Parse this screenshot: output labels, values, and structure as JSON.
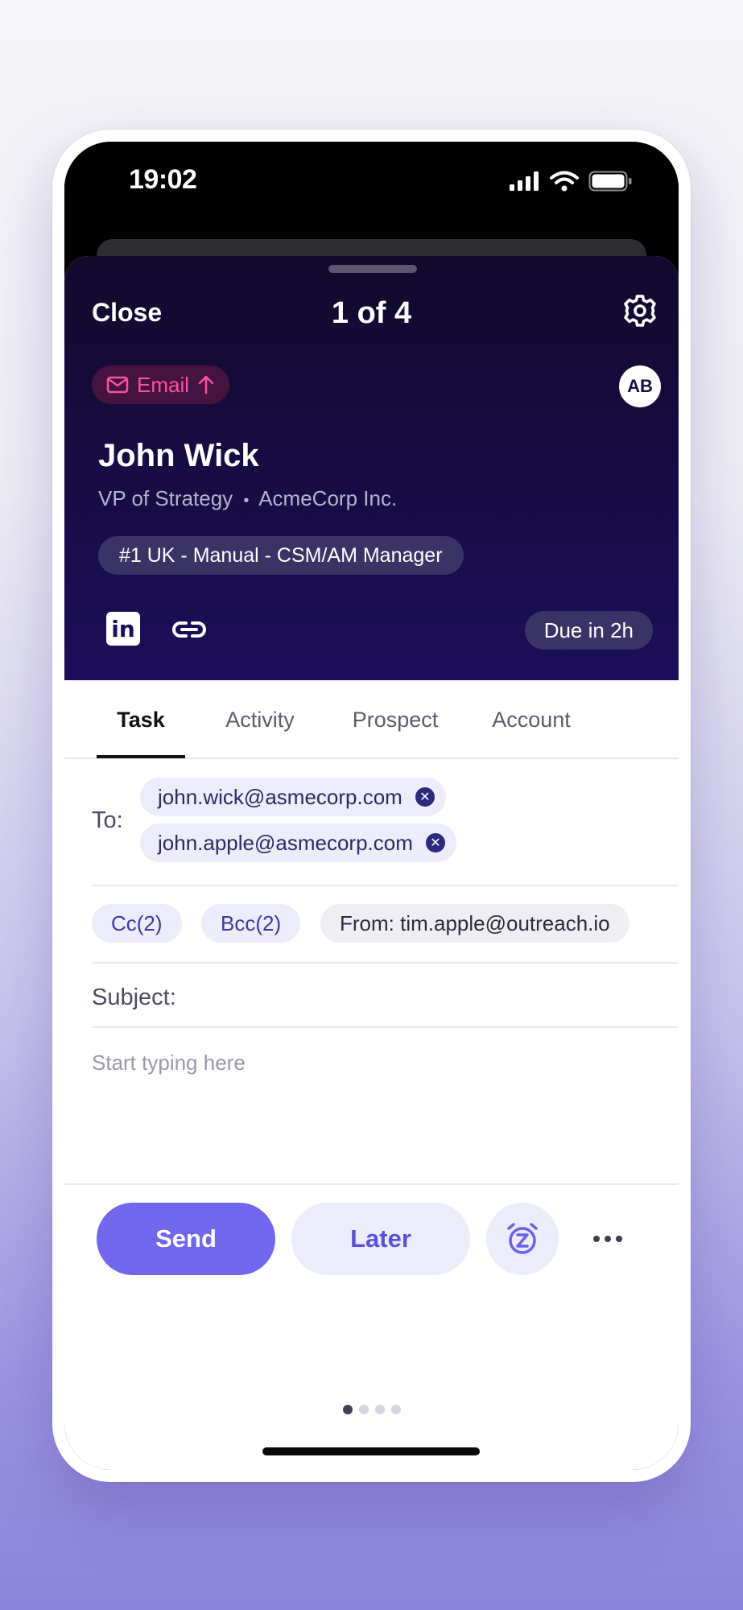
{
  "status_bar": {
    "time": "19:02"
  },
  "header": {
    "close_label": "Close",
    "counter": "1 of 4",
    "type_chip": "Email",
    "avatar_initials": "AB",
    "prospect_name": "John Wick",
    "prospect_title": "VP of Strategy",
    "prospect_company": "AcmeCorp Inc.",
    "role_separator": "•",
    "sequence": "#1 UK - Manual - CSM/AM Manager",
    "linkedin_glyph": "in",
    "due": "Due in 2h"
  },
  "tabs": [
    {
      "label": "Task",
      "active": true
    },
    {
      "label": "Activity",
      "active": false
    },
    {
      "label": "Prospect",
      "active": false
    },
    {
      "label": "Account",
      "active": false
    }
  ],
  "compose": {
    "to_label": "To:",
    "recipients": [
      "john.wick@asmecorp.com",
      "john.apple@asmecorp.com"
    ],
    "cc_label": "Cc(2)",
    "bcc_label": "Bcc(2)",
    "from_label": "From: tim.apple@outreach.io",
    "subject_label": "Subject:",
    "body_placeholder": "Start typing here"
  },
  "pagination": {
    "total": 4,
    "current": 1
  },
  "actions": {
    "send_label": "Send",
    "later_label": "Later"
  },
  "colors": {
    "accent": "#7067ec",
    "email_chip": "#ff4f9e",
    "header_bg": "#1c0e5a"
  },
  "icons": {
    "gear": "gear-icon",
    "mail": "mail-icon",
    "arrow": "arrow-up-icon",
    "linkedin": "linkedin-icon",
    "link": "link-icon",
    "snooze": "alarm-snooze-icon",
    "more": "more-horizontal-icon"
  }
}
